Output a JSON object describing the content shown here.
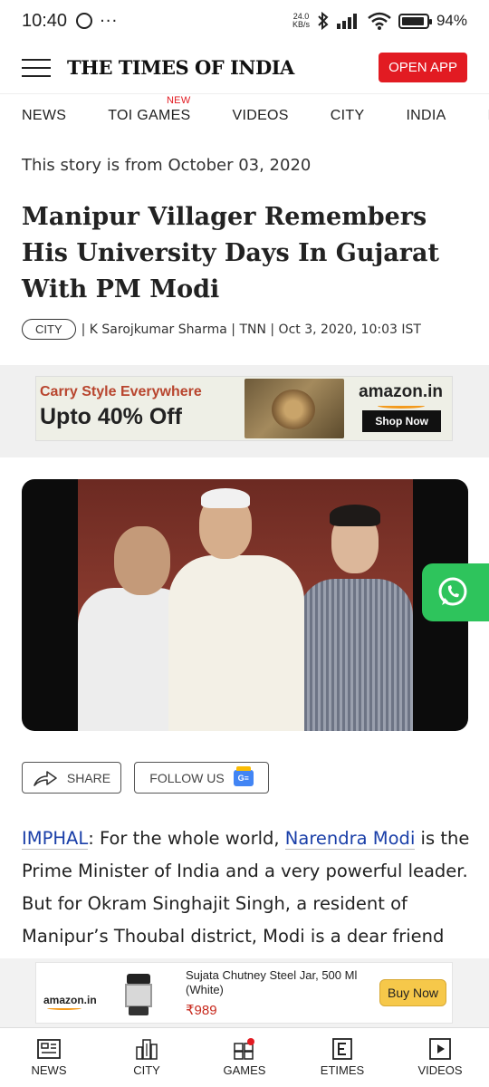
{
  "status_bar": {
    "time": "10:40",
    "more": "···",
    "speed_value": "24.0",
    "speed_unit": "KB/s",
    "battery_level": 0.94,
    "battery_percent": "94%"
  },
  "header": {
    "logo": "THE TIMES OF INDIA",
    "open_app": "OPEN APP",
    "accent": "#e21b22"
  },
  "nav": {
    "items": [
      "NEWS",
      "TOI GAMES",
      "VIDEOS",
      "CITY",
      "INDIA",
      "BU"
    ],
    "badge": "NEW"
  },
  "article": {
    "story_date": "This story is from October 03, 2020",
    "headline": "Manipur Villager Remembers His University Days In Gujarat With PM Modi",
    "category": "CITY",
    "byline": "| K Sarojkumar Sharma | TNN | Oct 3, 2020, 10:03 IST",
    "share": "SHARE",
    "follow": "FOLLOW US",
    "para": {
      "place_link": "IMPHAL",
      "t1": ": For the whole world, ",
      "name_link": "Narendra Modi",
      "t2": " is the Prime Minister of India and a very powerful leader. But for Okram Singhajit Singh, a resident of Manipur’s Thoubal district, Modi is a dear friend"
    }
  },
  "ad_banner": {
    "line1": "Carry Style Everywhere",
    "line2": "Upto 40% Off",
    "brand": "amazon.in",
    "cta": "Shop Now"
  },
  "ad_product": {
    "brand": "amazon.in",
    "title": "Sujata Chutney Steel Jar, 500 Ml (White)",
    "price": "₹989",
    "cta": "Buy Now"
  },
  "bottom_nav": {
    "items": [
      {
        "label": "NEWS",
        "icon": "news-icon"
      },
      {
        "label": "CITY",
        "icon": "city-icon"
      },
      {
        "label": "GAMES",
        "icon": "games-icon"
      },
      {
        "label": "ETIMES",
        "icon": "etimes-icon"
      },
      {
        "label": "VIDEOS",
        "icon": "videos-icon"
      }
    ]
  },
  "colors": {
    "link": "#1a3fa8",
    "whatsapp": "#2ec45c",
    "price": "#c7281c"
  }
}
